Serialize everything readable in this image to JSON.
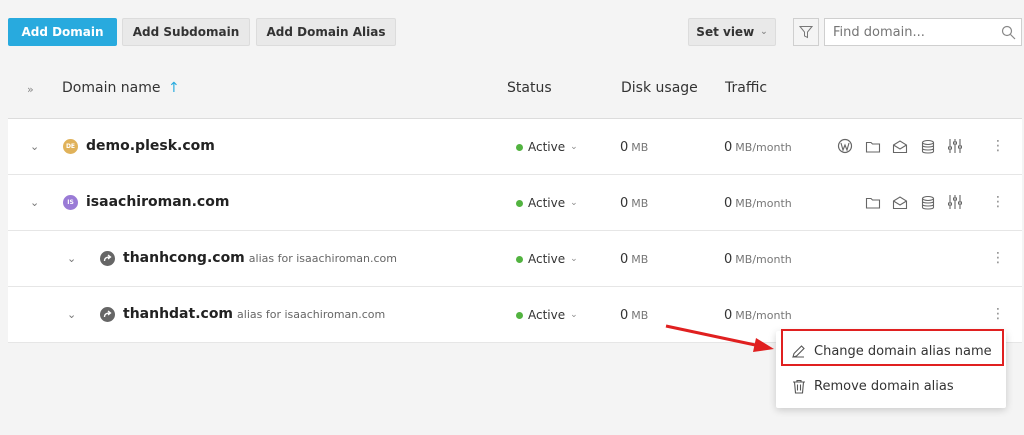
{
  "toolbar": {
    "add_domain": "Add Domain",
    "add_subdomain": "Add Subdomain",
    "add_domain_alias": "Add Domain Alias",
    "set_view": "Set view",
    "search_placeholder": "Find domain..."
  },
  "table": {
    "headers": {
      "domain_name": "Domain name",
      "status": "Status",
      "disk_usage": "Disk usage",
      "traffic": "Traffic"
    },
    "sort_indicator": "↑",
    "rows": [
      {
        "name": "demo.plesk.com",
        "icon_text": "DE",
        "icon_color": "#e0b25a",
        "alias_for": "",
        "status": "Active",
        "disk_value": "0",
        "disk_unit": "MB",
        "traffic_value": "0",
        "traffic_unit": "MB/month",
        "services": [
          "wordpress-icon",
          "folder-icon",
          "mail-icon",
          "database-icon",
          "sliders-icon"
        ]
      },
      {
        "name": "isaachiroman.com",
        "icon_text": "IS",
        "icon_color": "#9a7bd6",
        "alias_for": "",
        "status": "Active",
        "disk_value": "0",
        "disk_unit": "MB",
        "traffic_value": "0",
        "traffic_unit": "MB/month",
        "services": [
          "folder-icon",
          "mail-icon",
          "database-icon",
          "sliders-icon"
        ]
      },
      {
        "name": "thanhcong.com",
        "icon_text": "",
        "icon_color": "#666666",
        "alias_for": "alias for isaachiroman.com",
        "status": "Active",
        "disk_value": "0",
        "disk_unit": "MB",
        "traffic_value": "0",
        "traffic_unit": "MB/month",
        "services": []
      },
      {
        "name": "thanhdat.com",
        "icon_text": "",
        "icon_color": "#666666",
        "alias_for": "alias for isaachiroman.com",
        "status": "Active",
        "disk_value": "0",
        "disk_unit": "MB",
        "traffic_value": "0",
        "traffic_unit": "MB/month",
        "services": []
      }
    ]
  },
  "context_menu": {
    "change_alias_name": "Change domain alias name",
    "remove_alias": "Remove domain alias"
  },
  "colors": {
    "primary": "#28aade",
    "active_status": "#52b340",
    "highlight": "#e02020"
  }
}
